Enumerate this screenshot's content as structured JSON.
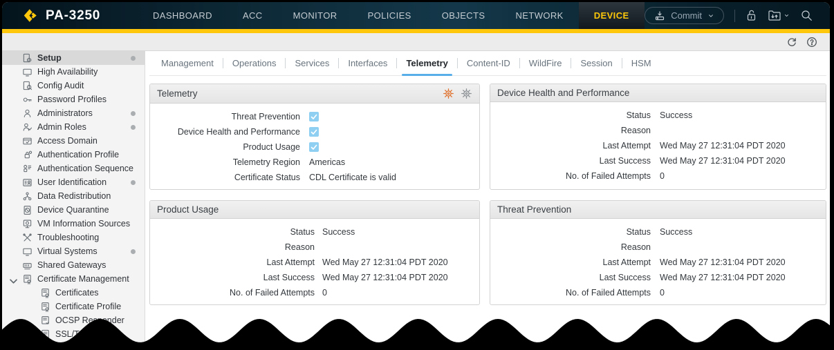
{
  "brand": {
    "device_name": "PA-3250",
    "logo_icon": "palo-alto-logo"
  },
  "topnav": {
    "items": [
      {
        "label": "DASHBOARD"
      },
      {
        "label": "ACC"
      },
      {
        "label": "MONITOR"
      },
      {
        "label": "POLICIES"
      },
      {
        "label": "OBJECTS"
      },
      {
        "label": "NETWORK"
      },
      {
        "label": "DEVICE"
      }
    ],
    "active": "DEVICE",
    "commit_label": "Commit",
    "icons": [
      "commit-icon",
      "chevron-down-icon",
      "unlock-icon",
      "config-operations-icon",
      "search-icon"
    ]
  },
  "toolbar": {
    "icons": [
      "refresh-icon",
      "help-icon"
    ]
  },
  "sidebar": {
    "items": [
      {
        "label": "Setup",
        "icon": "setup-icon",
        "selected": true,
        "dot": true
      },
      {
        "label": "High Availability",
        "icon": "high-availability-icon"
      },
      {
        "label": "Config Audit",
        "icon": "config-audit-icon"
      },
      {
        "label": "Password Profiles",
        "icon": "password-profiles-icon"
      },
      {
        "label": "Administrators",
        "icon": "administrators-icon",
        "dot": true
      },
      {
        "label": "Admin Roles",
        "icon": "admin-roles-icon",
        "dot": true
      },
      {
        "label": "Access Domain",
        "icon": "access-domain-icon"
      },
      {
        "label": "Authentication Profile",
        "icon": "authentication-profile-icon"
      },
      {
        "label": "Authentication Sequence",
        "icon": "authentication-sequence-icon"
      },
      {
        "label": "User Identification",
        "icon": "user-identification-icon",
        "dot": true
      },
      {
        "label": "Data Redistribution",
        "icon": "data-redistribution-icon"
      },
      {
        "label": "Device Quarantine",
        "icon": "device-quarantine-icon"
      },
      {
        "label": "VM Information Sources",
        "icon": "vm-information-sources-icon"
      },
      {
        "label": "Troubleshooting",
        "icon": "troubleshooting-icon"
      },
      {
        "label": "Virtual Systems",
        "icon": "virtual-systems-icon",
        "dot": true
      },
      {
        "label": "Shared Gateways",
        "icon": "shared-gateways-icon"
      },
      {
        "label": "Certificate Management",
        "icon": "certificate-management-icon",
        "expanded": true
      },
      {
        "label": "Certificates",
        "icon": "certificates-icon",
        "child": true
      },
      {
        "label": "Certificate Profile",
        "icon": "certificate-profile-icon",
        "child": true
      },
      {
        "label": "OCSP Responder",
        "icon": "ocsp-responder-icon",
        "child": true
      },
      {
        "label": "SSL/TLS Ser",
        "icon": "ssl-tls-icon",
        "child": true
      }
    ]
  },
  "content": {
    "tabs": [
      {
        "label": "Management"
      },
      {
        "label": "Operations"
      },
      {
        "label": "Services"
      },
      {
        "label": "Interfaces"
      },
      {
        "label": "Telemetry",
        "active": true
      },
      {
        "label": "Content-ID"
      },
      {
        "label": "WildFire"
      },
      {
        "label": "Session"
      },
      {
        "label": "HSM"
      }
    ],
    "panels": [
      {
        "title": "Telemetry",
        "header_icons": [
          "telemetry-settings-gear-icon",
          "gear-icon"
        ],
        "rows": [
          {
            "label": "Threat Prevention",
            "checkbox": "checked"
          },
          {
            "label": "Device Health and Performance",
            "checkbox": "checked"
          },
          {
            "label": "Product Usage",
            "checkbox": "checked"
          },
          {
            "label": "Telemetry Region",
            "value": "Americas"
          },
          {
            "label": "Certificate Status",
            "value": "CDL Certificate is valid"
          }
        ]
      },
      {
        "title": "Device Health and Performance",
        "rows": [
          {
            "label": "Status",
            "value": "Success"
          },
          {
            "label": "Reason",
            "value": ""
          },
          {
            "label": "Last Attempt",
            "value": "Wed May 27 12:31:04 PDT 2020"
          },
          {
            "label": "Last Success",
            "value": "Wed May 27 12:31:04 PDT 2020"
          },
          {
            "label": "No. of Failed Attempts",
            "value": "0"
          }
        ]
      },
      {
        "title": "Product Usage",
        "rows": [
          {
            "label": "Status",
            "value": "Success"
          },
          {
            "label": "Reason",
            "value": ""
          },
          {
            "label": "Last Attempt",
            "value": "Wed May 27 12:31:04 PDT 2020"
          },
          {
            "label": "Last Success",
            "value": "Wed May 27 12:31:04 PDT 2020"
          },
          {
            "label": "No. of Failed Attempts",
            "value": "0"
          }
        ]
      },
      {
        "title": "Threat Prevention",
        "rows": [
          {
            "label": "Status",
            "value": "Success"
          },
          {
            "label": "Reason",
            "value": ""
          },
          {
            "label": "Last Attempt",
            "value": "Wed May 27 12:31:04 PDT 2020"
          },
          {
            "label": "Last Success",
            "value": "Wed May 27 12:31:04 PDT 2020"
          },
          {
            "label": "No. of Failed Attempts",
            "value": "0"
          }
        ]
      }
    ]
  },
  "colors": {
    "accent_yellow": "#FEC70C",
    "nav_background": "#0D2835",
    "active_tab_text": "#FCC60A",
    "tab_underline_blue": "#57AEE9",
    "checkbox_blue": "#8FD0F2"
  }
}
